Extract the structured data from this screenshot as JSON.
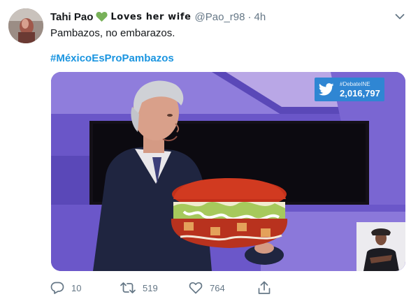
{
  "user": {
    "display_name": "Tahi Pao",
    "name_suffix": "Loves her wife",
    "handle": "@Pao_r98",
    "separator": "·",
    "time": "4h"
  },
  "tweet": {
    "text": "Pambazos, no embarazos.",
    "hashtag": "#MéxicoEsProPambazos"
  },
  "media": {
    "badge_tag": "#DebateINE",
    "badge_count": "2,016,797"
  },
  "actions": {
    "replies": "10",
    "retweets": "519",
    "likes": "764"
  },
  "colors": {
    "link": "#1b95e0",
    "secondary_text": "#657786",
    "heart": "#78b159"
  },
  "icons": [
    "green-heart-icon",
    "caret-down-icon",
    "twitter-bird-icon",
    "reply-icon",
    "retweet-icon",
    "like-icon",
    "share-icon"
  ]
}
